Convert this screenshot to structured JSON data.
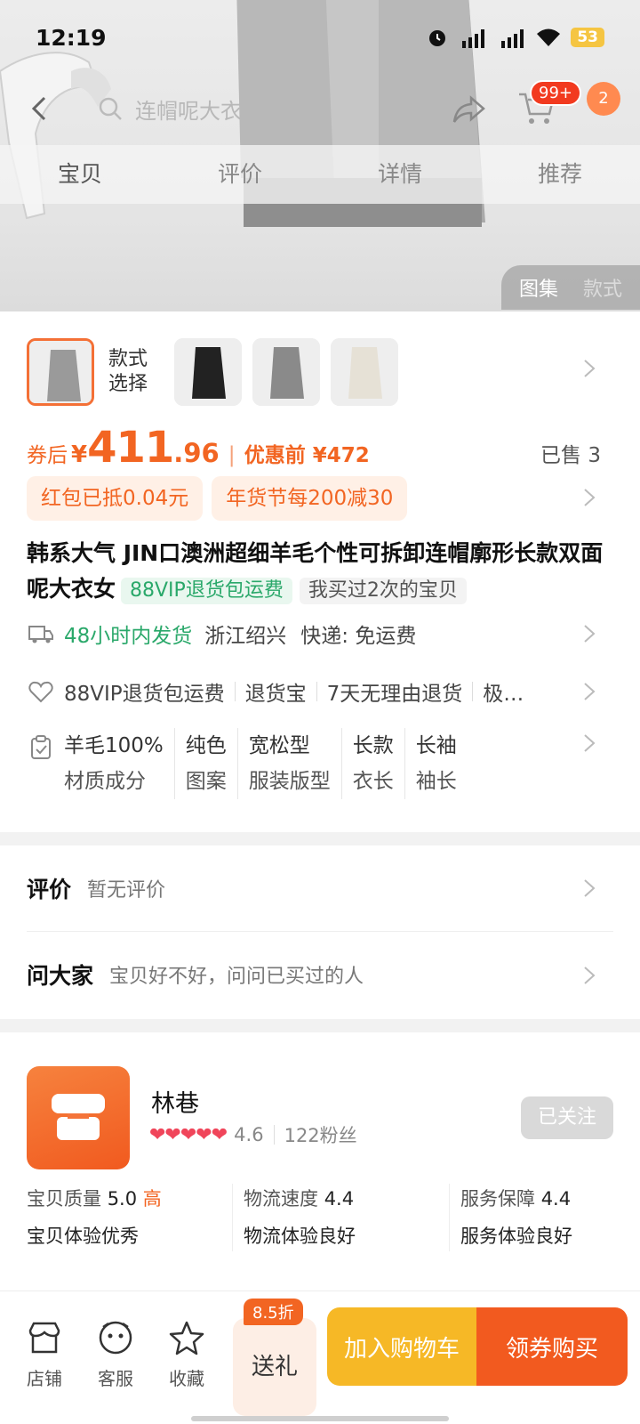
{
  "status": {
    "time": "12:19",
    "battery": "53"
  },
  "header": {
    "search_placeholder": "连帽呢大衣",
    "cart_badge": "99+",
    "message_badge": "2"
  },
  "tabs": [
    "宝贝",
    "评价",
    "详情",
    "推荐"
  ],
  "gallery": {
    "left": "图集",
    "right": "款式"
  },
  "variants": {
    "label": "款式选择"
  },
  "price": {
    "after_coupon_label": "券后",
    "currency": "¥",
    "int": "411",
    "dec": ".96",
    "before_label": "优惠前 ¥472",
    "sold": "已售 3"
  },
  "promos": [
    "红包已抵0.04元",
    "年货节每200减30"
  ],
  "product": {
    "title": "韩系大气 JIN口澳洲超细羊毛个性可拆卸连帽廓形长款双面呢大衣女",
    "vip_tag": "88VIP退货包运费",
    "bought_tag": "我买过2次的宝贝"
  },
  "shipping": {
    "fast": "48小时内发货",
    "origin": "浙江绍兴",
    "express": "快递: 免运费"
  },
  "guarantees": [
    "88VIP退货包运费",
    "退货宝",
    "7天无理由退货",
    "极…"
  ],
  "attributes": [
    {
      "value": "羊毛100%",
      "key": "材质成分"
    },
    {
      "value": "纯色",
      "key": "图案"
    },
    {
      "value": "宽松型",
      "key": "服装版型"
    },
    {
      "value": "长款",
      "key": "衣长"
    },
    {
      "value": "长袖",
      "key": "袖长"
    }
  ],
  "reviews": {
    "title": "评价",
    "sub": "暂无评价"
  },
  "qa": {
    "title": "问大家",
    "sub": "宝贝好不好，问问已买过的人"
  },
  "shop": {
    "name": "林巷",
    "hearts": "❤❤❤❤❤",
    "rating": "4.6",
    "fans": "122粉丝",
    "follow_label": "已关注",
    "scores": [
      {
        "label": "宝贝质量",
        "value": "5.0",
        "level": "高",
        "desc": "宝贝体验优秀"
      },
      {
        "label": "物流速度",
        "value": "4.4",
        "level": "",
        "desc": "物流体验良好"
      },
      {
        "label": "服务保障",
        "value": "4.4",
        "level": "",
        "desc": "服务体验良好"
      }
    ]
  },
  "bottom": {
    "store": "店铺",
    "service": "客服",
    "favorite": "收藏",
    "gift": "送礼",
    "gift_discount": "8.5折",
    "add_to_cart": "加入购物车",
    "buy": "领券购买"
  },
  "colors": {
    "accent": "#f26522",
    "green": "#2aa86a",
    "cart_btn": "#f6b826",
    "buy_btn": "#f25a1f"
  }
}
